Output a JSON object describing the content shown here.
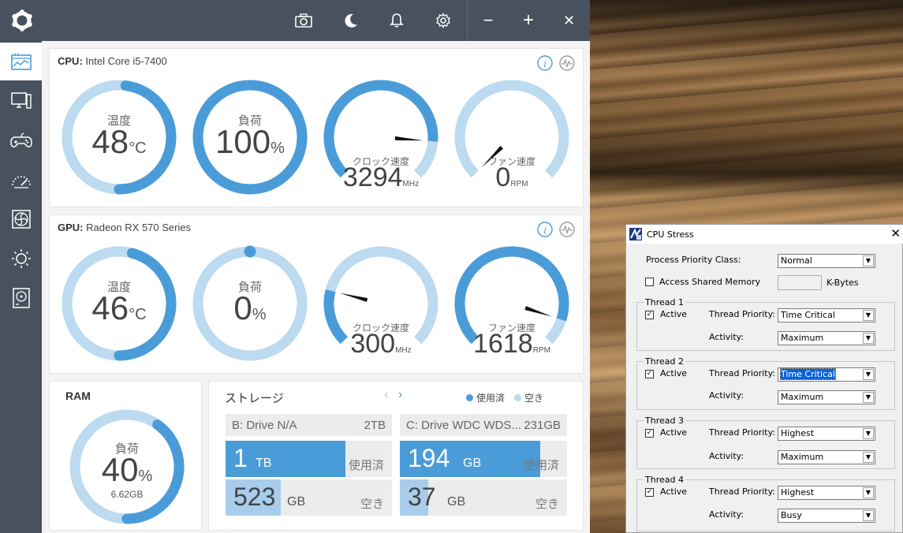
{
  "cpu": {
    "label": "CPU:",
    "name": "Intel Core i5-7400",
    "temp": {
      "label": "温度",
      "value": "48",
      "unit": "°C",
      "fraction": 0.48
    },
    "load": {
      "label": "負荷",
      "value": "100",
      "unit": "%",
      "fraction": 1.0
    },
    "clock": {
      "label": "クロック速度",
      "value": "3294",
      "unit": "MHz",
      "fraction": 0.85
    },
    "fan": {
      "label": "ファン速度",
      "value": "0",
      "unit": "RPM",
      "fraction": 0.0
    }
  },
  "gpu": {
    "label": "GPU:",
    "name": "Radeon RX 570 Series",
    "temp": {
      "label": "温度",
      "value": "46",
      "unit": "°C",
      "fraction": 0.46
    },
    "load": {
      "label": "負荷",
      "value": "0",
      "unit": "%",
      "fraction": 0.0
    },
    "clock": {
      "label": "クロック速度",
      "value": "300",
      "unit": "MHz",
      "fraction": 0.22
    },
    "fan": {
      "label": "ファン速度",
      "value": "1618",
      "unit": "RPM",
      "fraction": 0.9
    }
  },
  "ram": {
    "title": "RAM",
    "label": "負荷",
    "value": "40",
    "unit": "%",
    "size": "6.62GB",
    "fraction": 0.4
  },
  "storage": {
    "title": "ストレージ",
    "legend_used": "使用済",
    "legend_free": "空き",
    "drives": [
      {
        "name": "B: Drive N/A",
        "size": "2TB",
        "used_value": "1",
        "used_unit": "TB",
        "used_label": "使用済",
        "free_value": "523",
        "free_unit": "GB",
        "free_label": "空き",
        "used_fraction": 0.72,
        "free_fraction": 0.33
      },
      {
        "name": "C: Drive WDC WDS...",
        "size": "231GB",
        "used_value": "194",
        "used_unit": "GB",
        "used_label": "使用済",
        "free_value": "37",
        "free_unit": "GB",
        "free_label": "空き",
        "used_fraction": 0.84,
        "free_fraction": 0.17
      }
    ]
  },
  "colors": {
    "accent": "#4a9cd8",
    "track": "#bcdaf0",
    "chrome": "#47525e"
  },
  "titlebar": {
    "icons": [
      "camera-icon",
      "moon-icon",
      "bell-icon",
      "gear-icon"
    ],
    "minimize": "−",
    "maximize": "+",
    "close": "✕"
  },
  "sidebar": {
    "items": [
      "dashboard-icon",
      "monitor-icon",
      "gamepad-icon",
      "speedometer-icon",
      "fan-icon",
      "brightness-icon",
      "storage-icon"
    ]
  },
  "dialog": {
    "title": "CPU Stress",
    "close": "✕",
    "priority_class_label": "Process Priority Class:",
    "priority_class_value": "Normal",
    "shared_memory_label": "Access Shared Memory",
    "kbytes_label": "K-Bytes",
    "active_label": "Active",
    "thread_priority_label": "Thread Priority:",
    "activity_label": "Activity:",
    "threads": [
      {
        "title": "Thread 1",
        "priority": "Time Critical",
        "activity": "Maximum",
        "active": true
      },
      {
        "title": "Thread 2",
        "priority": "Time Critical",
        "activity": "Maximum",
        "active": true
      },
      {
        "title": "Thread 3",
        "priority": "Highest",
        "activity": "Maximum",
        "active": true
      },
      {
        "title": "Thread 4",
        "priority": "Highest",
        "activity": "Busy",
        "active": true
      }
    ]
  }
}
